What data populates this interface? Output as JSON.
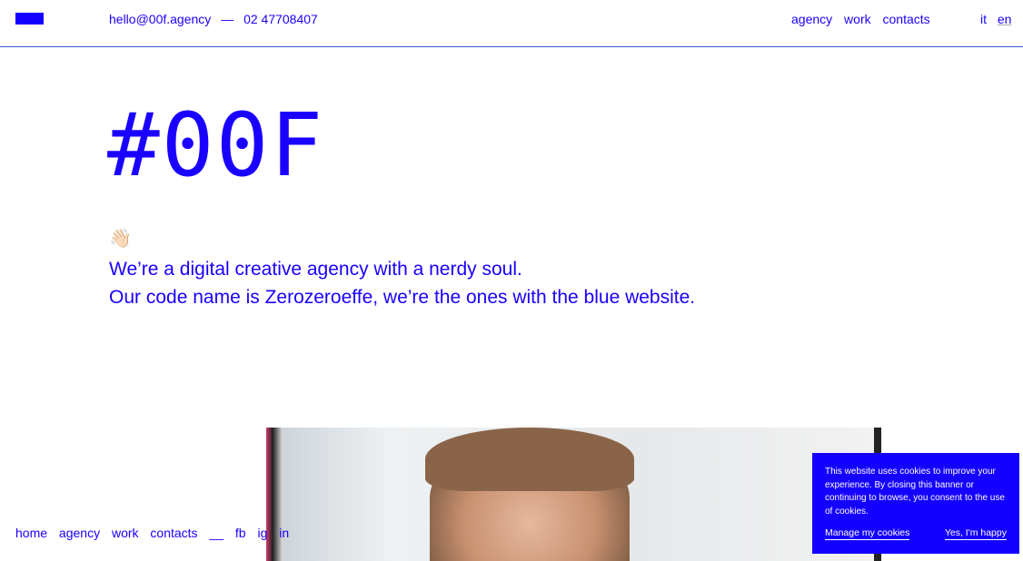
{
  "header": {
    "email": "hello@00f.agency",
    "separator": "—",
    "phone": "02 47708407",
    "nav": [
      "agency",
      "work",
      "contacts"
    ],
    "languages": [
      "it",
      "en"
    ],
    "active_language": "en"
  },
  "hero": {
    "title": "#00F",
    "emoji": "👋🏻",
    "line1": "We’re a digital creative agency with a nerdy soul.",
    "line2": "Our code name is Zerozeroeffe, we’re the ones with the blue website."
  },
  "footer_nav": [
    "home",
    "agency",
    "work",
    "contacts",
    "__",
    "fb",
    "ig",
    "in"
  ],
  "cookie": {
    "text": "This website uses cookies to improve your experience. By closing this banner or continuing to browse, you consent to the use of cookies.",
    "manage": "Manage my cookies",
    "accept": "Yes, I'm happy"
  },
  "colors": {
    "brand": "#1400ff"
  }
}
